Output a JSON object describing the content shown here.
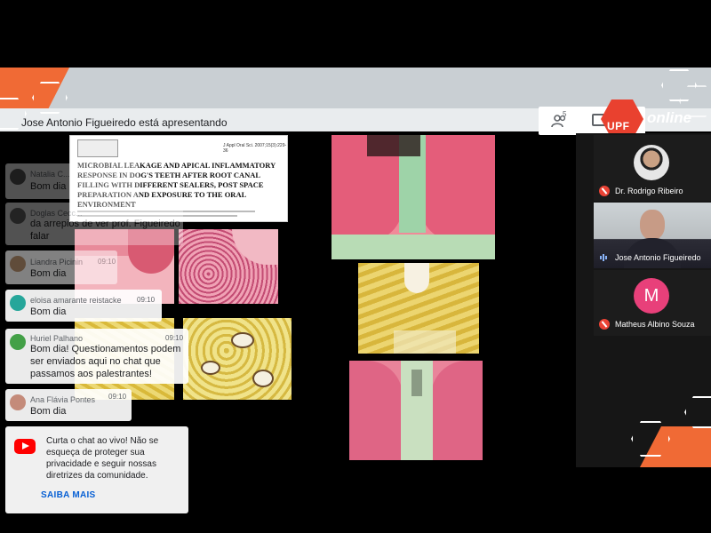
{
  "meet": {
    "presenting_text": "Jose Antonio Figueiredo está apresentando",
    "participant_count": "5",
    "brand": {
      "logo_text": "UPF",
      "suffix": "online",
      "accent": "#f06a35",
      "logo_color": "#e9412f"
    }
  },
  "participants": [
    {
      "name": "Dr. Rodrigo Ribeiro",
      "muted": true
    },
    {
      "name": "Jose Antonio Figueiredo",
      "muted": false,
      "speaking": true
    },
    {
      "name": "Matheus Albino Souza",
      "initial": "M",
      "muted": true,
      "avatar_color": "#e8407a"
    }
  ],
  "slide": {
    "paper_ref": "J Appl Oral Sci. 2007;15(3):229-36",
    "paper_title": "MICROBIAL LEAKAGE AND APICAL INFLAMMATORY RESPONSE IN DOG'S TEETH AFTER ROOT CANAL FILLING WITH DIFFERENT SEALERS, POST SPACE PREPARATION AND EXPOSURE TO THE ORAL ENVIRONMENT"
  },
  "chat": {
    "messages": [
      {
        "author": "Natalia C...",
        "time": "",
        "text": "Bom dia",
        "faded": true
      },
      {
        "author": "Doglas Cecc...",
        "time": "",
        "text": "da arrepios de ver prof. Figueiredo falar",
        "faded": true
      },
      {
        "author": "Liandra Picinin",
        "time": "09:10",
        "text": "Bom dia",
        "faded": true
      },
      {
        "author": "eloisa amarante reistacke",
        "time": "09:10",
        "text": "Bom dia"
      },
      {
        "author": "Huriel Palhano",
        "time": "09:10",
        "text": "Bom dia! Questionamentos podem ser enviados aqui no chat que passamos aos palestrantes!"
      },
      {
        "author": "Ana Flávia Pontes",
        "time": "09:10",
        "text": "Bom dia"
      }
    ],
    "promo": {
      "text": "Curta o chat ao vivo! Não se esqueça de proteger sua privacidade e seguir nossas diretrizes da comunidade.",
      "link": "SAIBA MAIS"
    }
  }
}
